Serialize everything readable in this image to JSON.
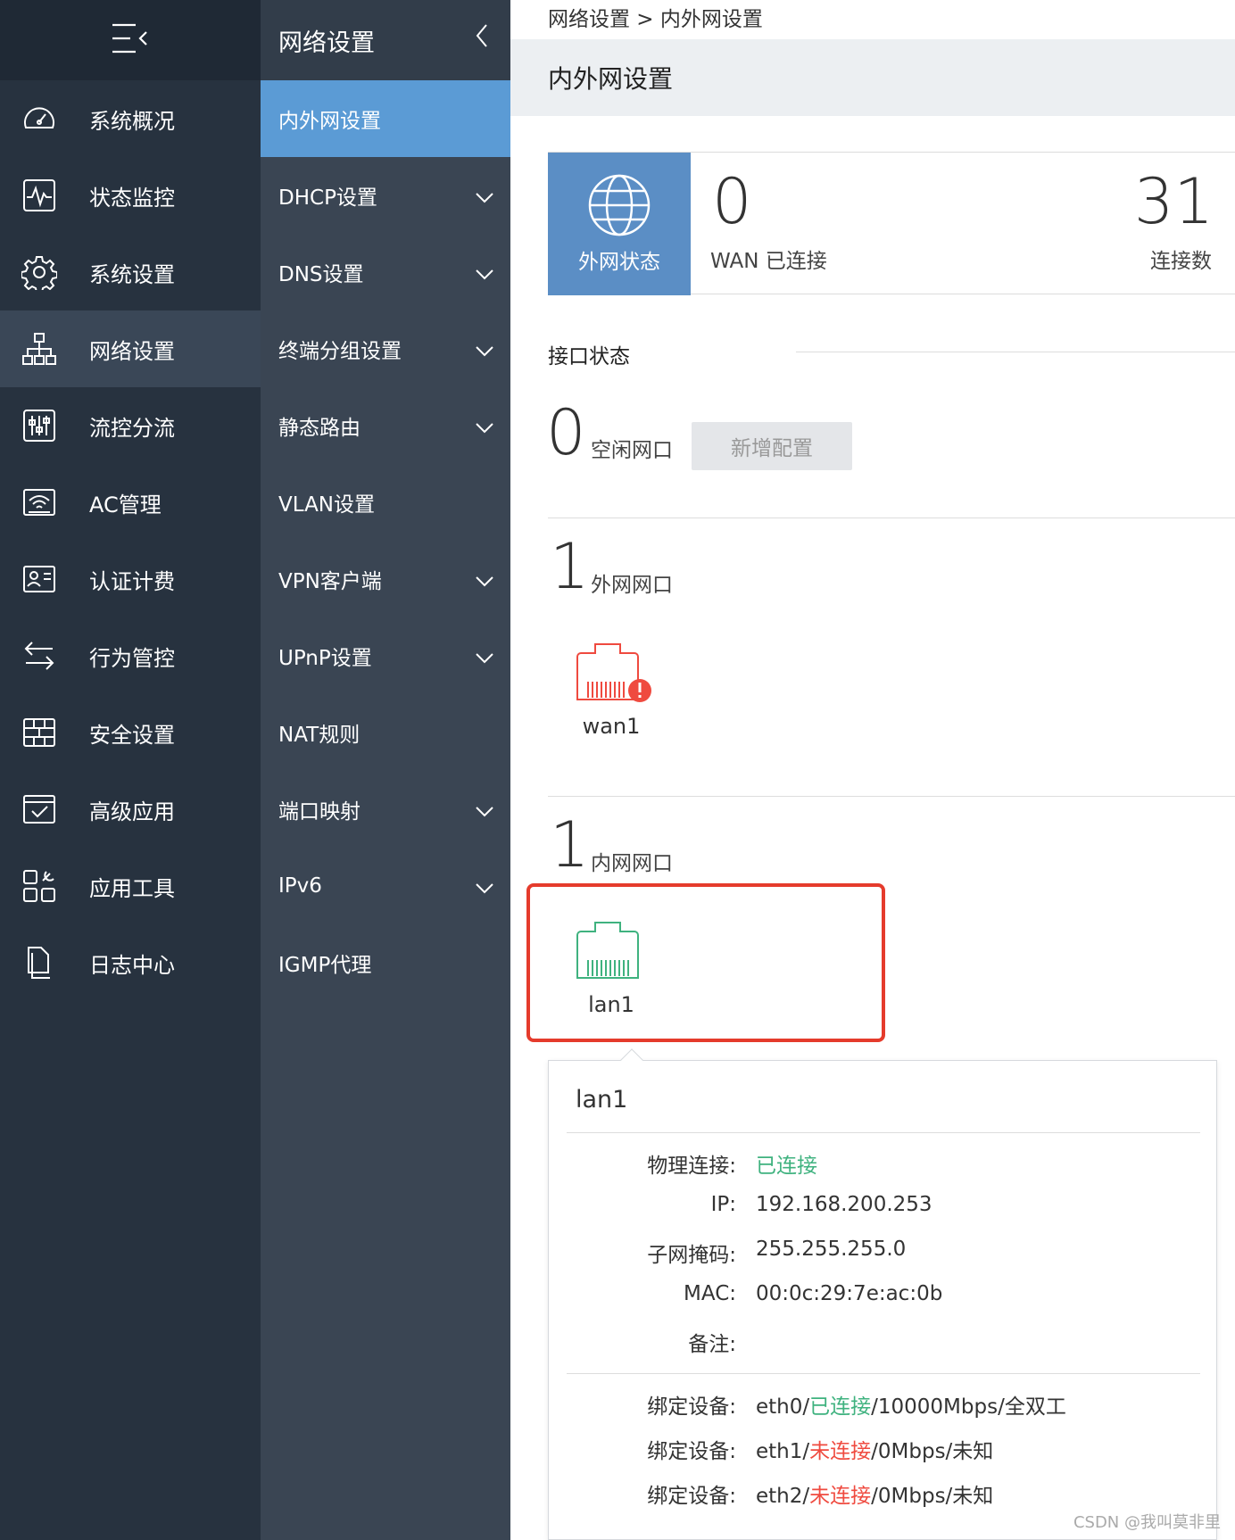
{
  "sidebar": {
    "items": [
      {
        "label": "系统概况",
        "icon": "dashboard-icon"
      },
      {
        "label": "状态监控",
        "icon": "monitor-icon"
      },
      {
        "label": "系统设置",
        "icon": "gear-icon"
      },
      {
        "label": "网络设置",
        "icon": "network-icon"
      },
      {
        "label": "流控分流",
        "icon": "sliders-icon"
      },
      {
        "label": "AC管理",
        "icon": "wifi-icon"
      },
      {
        "label": "认证计费",
        "icon": "id-card-icon"
      },
      {
        "label": "行为管控",
        "icon": "swap-arrows-icon"
      },
      {
        "label": "安全设置",
        "icon": "firewall-icon"
      },
      {
        "label": "高级应用",
        "icon": "checklist-icon"
      },
      {
        "label": "应用工具",
        "icon": "tools-grid-icon"
      },
      {
        "label": "日志中心",
        "icon": "document-icon"
      }
    ]
  },
  "submenu": {
    "title": "网络设置",
    "items": [
      {
        "label": "内外网设置"
      },
      {
        "label": "DHCP设置"
      },
      {
        "label": "DNS设置"
      },
      {
        "label": "终端分组设置"
      },
      {
        "label": "静态路由"
      },
      {
        "label": "VLAN设置"
      },
      {
        "label": "VPN客户端"
      },
      {
        "label": "UPnP设置"
      },
      {
        "label": "NAT规则"
      },
      {
        "label": "端口映射"
      },
      {
        "label": "IPv6"
      },
      {
        "label": "IGMP代理"
      }
    ]
  },
  "main": {
    "breadcrumb": "网络设置 > 内外网设置",
    "page_title": "内外网设置",
    "wan_status": {
      "tile_label": "外网状态",
      "connected_count": "0",
      "connected_label": "WAN 已连接",
      "connections_count": "31",
      "connections_label": "连接数"
    },
    "interfaces": {
      "title": "接口状态",
      "idle_count": "0",
      "idle_label": "空闲网口",
      "add_button": "新增配置",
      "wan_count": "1",
      "wan_label": "外网网口",
      "wan_port": "wan1",
      "lan_count": "1",
      "lan_label": "内网网口",
      "lan_port": "lan1"
    },
    "popup": {
      "title": "lan1",
      "physical_key": "物理连接:",
      "physical_value": "已连接",
      "ip_key": "IP:",
      "ip_value": "192.168.200.253",
      "mask_key": "子网掩码:",
      "mask_value": "255.255.255.0",
      "mac_key": "MAC:",
      "mac_value": "00:0c:29:7e:ac:0b",
      "note_key": "备注:",
      "note_value": "",
      "bindings": [
        {
          "key": "绑定设备:",
          "dev": "eth0/",
          "state": "已连接",
          "rest": "/10000Mbps/全双工"
        },
        {
          "key": "绑定设备:",
          "dev": "eth1/",
          "state": "未连接",
          "rest": "/0Mbps/未知"
        },
        {
          "key": "绑定设备:",
          "dev": "eth2/",
          "state": "未连接",
          "rest": "/0Mbps/未知"
        }
      ]
    }
  },
  "watermark": "CSDN @我叫莫非里",
  "colors": {
    "sidebar_bg": "#27323f",
    "submenu_bg": "#3a4553",
    "active_blue": "#5b9bd5",
    "wan_tile": "#5b8ec5",
    "ok_green": "#3fb27f",
    "error_red": "#ef4a3f",
    "highlight_red": "#e53b2c"
  }
}
